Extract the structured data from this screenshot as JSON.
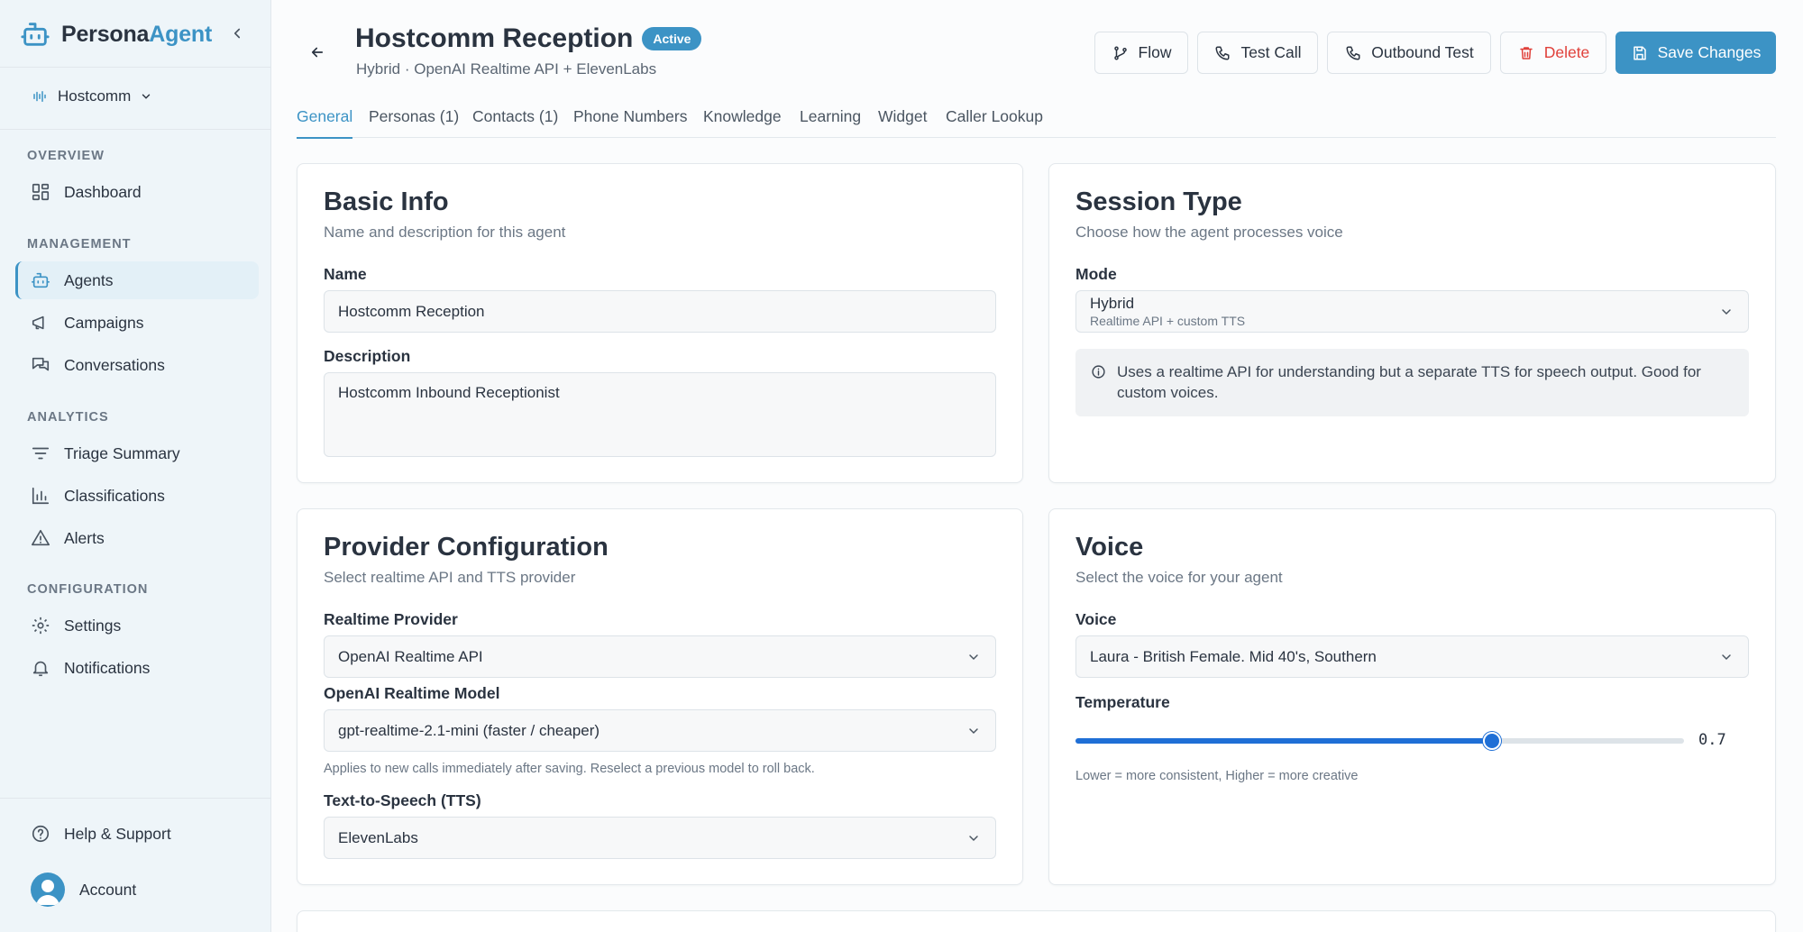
{
  "brand": {
    "name_part1": "Persona",
    "name_part2": "Agent"
  },
  "org": {
    "name": "Hostcomm"
  },
  "sidebar": {
    "sections": [
      {
        "label": "OVERVIEW"
      },
      {
        "label": "MANAGEMENT"
      },
      {
        "label": "ANALYTICS"
      },
      {
        "label": "CONFIGURATION"
      }
    ],
    "items": [
      {
        "label": "Dashboard",
        "icon": "grid-icon"
      },
      {
        "label": "Agents",
        "icon": "robot-icon",
        "active": true
      },
      {
        "label": "Campaigns",
        "icon": "megaphone-icon"
      },
      {
        "label": "Conversations",
        "icon": "chat-bubbles-icon"
      },
      {
        "label": "Triage Summary",
        "icon": "filter-lines-icon"
      },
      {
        "label": "Classifications",
        "icon": "bar-chart-icon"
      },
      {
        "label": "Alerts",
        "icon": "warning-triangle-icon"
      },
      {
        "label": "Settings",
        "icon": "gear-icon"
      },
      {
        "label": "Notifications",
        "icon": "bell-icon"
      }
    ],
    "help": {
      "label": "Help & Support"
    },
    "account": {
      "label": "Account"
    }
  },
  "header": {
    "title": "Hostcomm Reception",
    "status": "Active",
    "subtitle": "Hybrid · OpenAI Realtime API + ElevenLabs",
    "buttons": {
      "flow": "Flow",
      "test_call": "Test Call",
      "outbound_test": "Outbound Test",
      "delete": "Delete",
      "save": "Save Changes"
    }
  },
  "tabs": [
    "General",
    "Personas (1)",
    "Contacts (1)",
    "Phone Numbers",
    "Knowledge",
    "Learning",
    "Widget",
    "Caller Lookup"
  ],
  "basic_info": {
    "title": "Basic Info",
    "description": "Name and description for this agent",
    "name_label": "Name",
    "name_value": "Hostcomm Reception",
    "desc_label": "Description",
    "desc_value": "Hostcomm Inbound Receptionist"
  },
  "session_type": {
    "title": "Session Type",
    "description": "Choose how the agent processes voice",
    "mode_label": "Mode",
    "mode_value": "Hybrid",
    "mode_sub": "Realtime API + custom TTS",
    "info": "Uses a realtime API for understanding but a separate TTS for speech output. Good for custom voices."
  },
  "provider": {
    "title": "Provider Configuration",
    "description": "Select realtime API and TTS provider",
    "realtime_label": "Realtime Provider",
    "realtime_value": "OpenAI Realtime API",
    "model_label": "OpenAI Realtime Model",
    "model_value": "gpt-realtime-2.1-mini (faster / cheaper)",
    "model_help": "Applies to new calls immediately after saving. Reselect a previous model to roll back.",
    "tts_label": "Text-to-Speech (TTS)",
    "tts_value": "ElevenLabs"
  },
  "voice": {
    "title": "Voice",
    "description": "Select the voice for your agent",
    "voice_label": "Voice",
    "voice_value": "Laura - British Female. Mid 40's, Southern",
    "temp_label": "Temperature",
    "temp_value": "0.7",
    "temp_fraction": 0.685,
    "temp_help": "Lower = more consistent, Higher = more creative"
  },
  "colors": {
    "accent": "#3c93c5",
    "danger": "#e0403a",
    "slider": "#1f6fd6"
  }
}
